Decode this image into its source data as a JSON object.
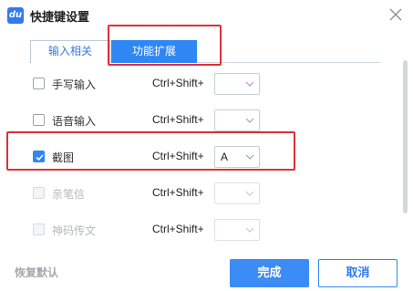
{
  "window": {
    "title": "快捷键设置",
    "logo_text": "du"
  },
  "tabs": [
    {
      "label": "输入相关",
      "active": false
    },
    {
      "label": "功能扩展",
      "active": true
    }
  ],
  "items": [
    {
      "label": "手写输入",
      "checked": false,
      "enabled": true,
      "combo": "Ctrl+Shift+",
      "key": ""
    },
    {
      "label": "语音输入",
      "checked": false,
      "enabled": true,
      "combo": "Ctrl+Shift+",
      "key": ""
    },
    {
      "label": "截图",
      "checked": true,
      "enabled": true,
      "combo": "Ctrl+Shift+",
      "key": "A"
    },
    {
      "label": "亲笔信",
      "checked": false,
      "enabled": false,
      "combo": "Ctrl+Shift+",
      "key": ""
    },
    {
      "label": "神码传文",
      "checked": false,
      "enabled": false,
      "combo": "Ctrl+Shift+",
      "key": ""
    }
  ],
  "footer": {
    "restore_label": "恢复默认",
    "ok_label": "完成",
    "cancel_label": "取消"
  },
  "colors": {
    "accent": "#2f87f4",
    "highlight": "#e02f37"
  },
  "icons": {
    "logo": "du-logo-icon",
    "close": "close-icon",
    "dropdown": "chevron-down-icon",
    "check": "checkmark-icon"
  }
}
